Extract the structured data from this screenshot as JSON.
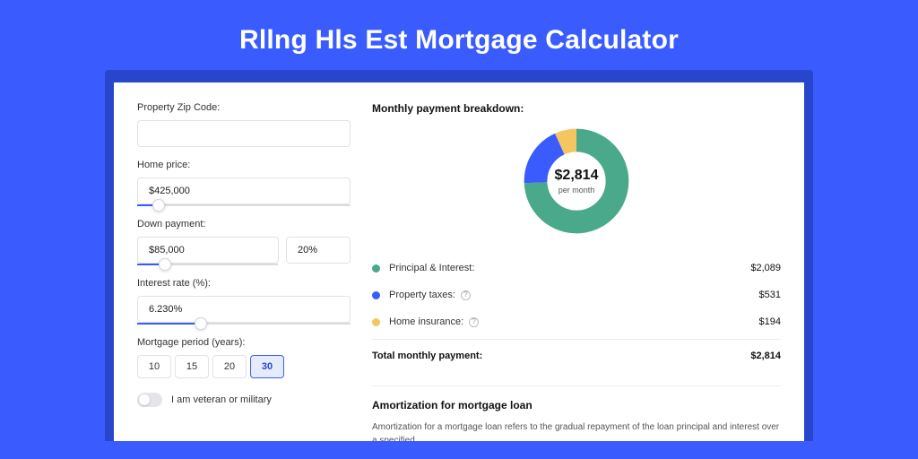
{
  "title": "Rllng Hls Est Mortgage Calculator",
  "left": {
    "zip_label": "Property Zip Code:",
    "zip_value": "",
    "home_price_label": "Home price:",
    "home_price_value": "$425,000",
    "home_price_slider_pct": 10,
    "down_payment_label": "Down payment:",
    "down_payment_amount": "$85,000",
    "down_payment_pct": "20%",
    "down_payment_slider_pct": 20,
    "interest_label": "Interest rate (%):",
    "interest_value": "6.230%",
    "interest_slider_pct": 30,
    "period_label": "Mortgage period (years):",
    "periods": [
      "10",
      "15",
      "20",
      "30"
    ],
    "period_selected": "30",
    "veteran_label": "I am veteran or military",
    "veteran_on": false
  },
  "right": {
    "breakdown_title": "Monthly payment breakdown:",
    "center_amount": "$2,814",
    "center_sub": "per month",
    "items": [
      {
        "label": "Principal & Interest:",
        "value": "$2,089",
        "color": "#4aa98a",
        "info": false
      },
      {
        "label": "Property taxes:",
        "value": "$531",
        "color": "#3a5cff",
        "info": true
      },
      {
        "label": "Home insurance:",
        "value": "$194",
        "color": "#f5c560",
        "info": true
      }
    ],
    "total_label": "Total monthly payment:",
    "total_value": "$2,814",
    "amort_title": "Amortization for mortgage loan",
    "amort_text": "Amortization for a mortgage loan refers to the gradual repayment of the loan principal and interest over a specified"
  },
  "chart_data": {
    "type": "pie",
    "title": "Monthly payment breakdown",
    "series": [
      {
        "name": "Principal & Interest",
        "value": 2089,
        "color": "#4aa98a"
      },
      {
        "name": "Property taxes",
        "value": 531,
        "color": "#3a5cff"
      },
      {
        "name": "Home insurance",
        "value": 194,
        "color": "#f5c560"
      }
    ],
    "total": 2814,
    "center_label": "$2,814 per month"
  }
}
